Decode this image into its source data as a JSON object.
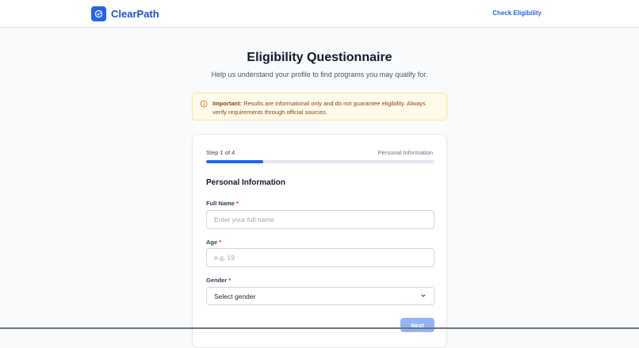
{
  "header": {
    "brand": "ClearPath",
    "nav_link": "Check Eligibility"
  },
  "page": {
    "title": "Eligibility Questionnaire",
    "subtitle": "Help us understand your profile to find programs you may qualify for."
  },
  "notice": {
    "label": "Important:",
    "text": "Results are informational only and do not guarantee eligibility. Always verify requirements through official sources."
  },
  "form": {
    "step_label": "Step 1 of 4",
    "step_name": "Personal Information",
    "progress": 0.25,
    "section_title": "Personal Information",
    "required_marker": "*",
    "fields": {
      "full_name": {
        "label": "Full Name",
        "placeholder": "Enter your full name",
        "value": ""
      },
      "age": {
        "label": "Age",
        "placeholder": "e.g. 19",
        "value": ""
      },
      "gender": {
        "label": "Gender",
        "selected": "Select gender"
      }
    },
    "next_label": "Next"
  },
  "colors": {
    "accent": "#2563eb",
    "notice_bg": "#fffbeb",
    "notice_text": "#92400e",
    "required": "#dc2626"
  },
  "icons": {
    "logo": "check-circle-icon",
    "notice": "info-circle-icon",
    "select": "chevron-down-icon"
  }
}
